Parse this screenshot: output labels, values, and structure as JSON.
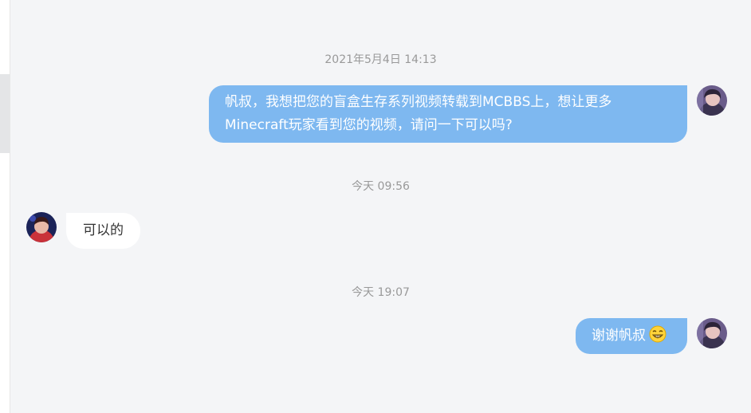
{
  "conversation": {
    "timestamps": [
      "2021年5月4日 14:13",
      "今天 09:56",
      "今天 19:07"
    ],
    "messages": [
      {
        "sender": "self",
        "lines": [
          "帆叔，我想把您的盲盒生存系列视频转载到MCBBS上，想让更多",
          "Minecraft玩家看到您的视频，请问一下可以吗?"
        ]
      },
      {
        "sender": "other",
        "text": "可以的"
      },
      {
        "sender": "self",
        "text": "谢谢帆叔",
        "emoji": "grinning-face-emoji"
      }
    ]
  },
  "colors": {
    "background": "#f4f5f7",
    "self_bubble": "#7eb8f0",
    "other_bubble": "#ffffff",
    "timestamp_text": "#999999"
  },
  "icons": {
    "self_avatar": "user-avatar-self",
    "other_avatar": "user-avatar-other",
    "emoji": "grinning-face-emoji"
  }
}
